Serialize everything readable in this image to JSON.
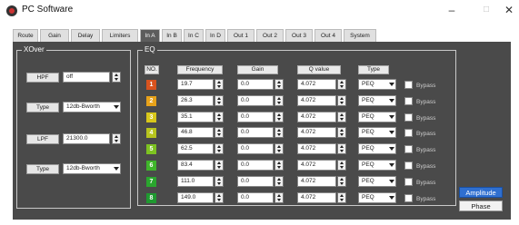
{
  "window": {
    "title": "PC Software",
    "minimize_glyph": "–",
    "maximize_glyph": "□",
    "close_glyph": "✕"
  },
  "tabs": [
    {
      "label": "Route",
      "active": false
    },
    {
      "label": "Gain",
      "active": false
    },
    {
      "label": "Delay",
      "active": false
    },
    {
      "label": "Limiters",
      "active": false
    },
    {
      "label": "In A",
      "active": true
    },
    {
      "label": "In B",
      "active": false
    },
    {
      "label": "In C",
      "active": false
    },
    {
      "label": "In D",
      "active": false
    },
    {
      "label": "Out 1",
      "active": false
    },
    {
      "label": "Out 2",
      "active": false
    },
    {
      "label": "Out 3",
      "active": false
    },
    {
      "label": "Out 4",
      "active": false
    },
    {
      "label": "System",
      "active": false
    }
  ],
  "xover": {
    "title": "XOver",
    "hpf": {
      "label": "HPF",
      "value": "off"
    },
    "hpf_type": {
      "label": "Type",
      "value": "12db-Bworth"
    },
    "lpf": {
      "label": "LPF",
      "value": "21300.0"
    },
    "lpf_type": {
      "label": "Type",
      "value": "12db-Bworth"
    }
  },
  "eq": {
    "title": "EQ",
    "headers": {
      "no": "NO.",
      "frequency": "Frequency",
      "gain": "Gain",
      "q": "Q value",
      "type": "Type"
    },
    "bypass_label": "Bypass",
    "rows": [
      {
        "no": "1",
        "color": "#d9531e",
        "frequency": "19.7",
        "gain": "0.0",
        "q": "4.072",
        "type": "PEQ"
      },
      {
        "no": "2",
        "color": "#e8a21a",
        "frequency": "26.3",
        "gain": "0.0",
        "q": "4.072",
        "type": "PEQ"
      },
      {
        "no": "3",
        "color": "#d8c71a",
        "frequency": "35.1",
        "gain": "0.0",
        "q": "4.072",
        "type": "PEQ"
      },
      {
        "no": "4",
        "color": "#b7c41e",
        "frequency": "46.8",
        "gain": "0.0",
        "q": "4.072",
        "type": "PEQ"
      },
      {
        "no": "5",
        "color": "#7dc221",
        "frequency": "62.5",
        "gain": "0.0",
        "q": "4.072",
        "type": "PEQ"
      },
      {
        "no": "6",
        "color": "#3fb52a",
        "frequency": "83.4",
        "gain": "0.0",
        "q": "4.072",
        "type": "PEQ"
      },
      {
        "no": "7",
        "color": "#2aa62e",
        "frequency": "111.0",
        "gain": "0.0",
        "q": "4.072",
        "type": "PEQ"
      },
      {
        "no": "8",
        "color": "#1f9a30",
        "frequency": "149.0",
        "gain": "0.0",
        "q": "4.072",
        "type": "PEQ"
      }
    ]
  },
  "view_buttons": {
    "amplitude": "Amplitude",
    "phase": "Phase"
  }
}
